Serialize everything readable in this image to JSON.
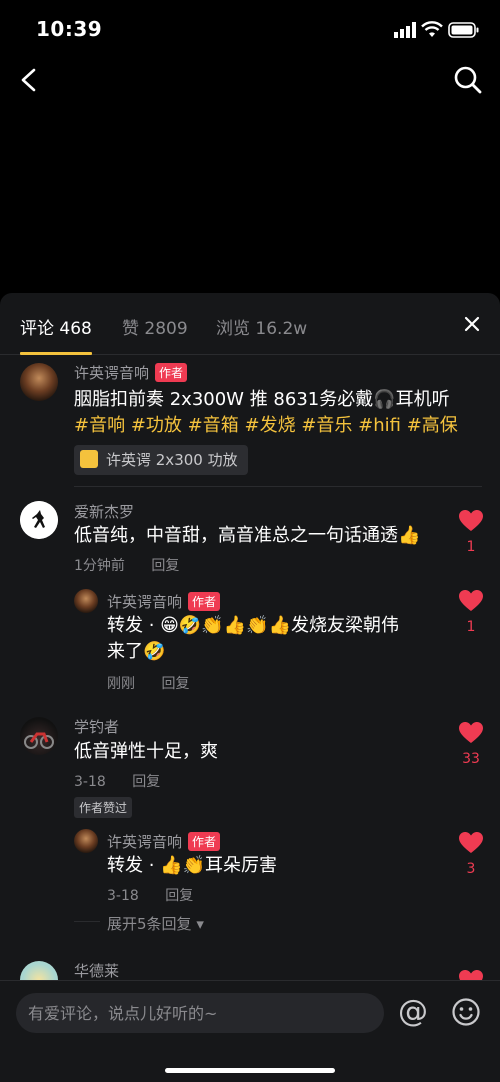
{
  "status": {
    "time": "10:39"
  },
  "tabs": {
    "comments": "评论 468",
    "likes": "赞 2809",
    "views": "浏览 16.2w"
  },
  "input": {
    "placeholder": "有爱评论，说点儿好听的~"
  },
  "author_badge": "作者",
  "reply_label": "回复",
  "post": {
    "user": "许英谔音响",
    "text_line1": "胭脂扣前奏 2x300W 推 8631务必戴🎧耳机听",
    "tags": [
      "#音响",
      "#功放",
      "#音箱",
      "#发烧",
      "#音乐",
      "#hifi",
      "#高保"
    ],
    "product": "许英谔 2x300 功放"
  },
  "comments": [
    {
      "user": "爱新杰罗",
      "text": "低音纯，中音甜，高音准总之一句话通透👍",
      "time": "1分钟前",
      "likes": "1",
      "reply": {
        "user": "许英谔音响",
        "text_line1": "转发 · 😁🤣👏👍👏👍发烧友梁朝伟",
        "text_line2": "来了🤣",
        "time": "刚刚",
        "likes": "1"
      }
    },
    {
      "user": "学钓者",
      "text": "低音弹性十足，爽",
      "time": "3-18",
      "likes": "33",
      "approved": "作者赞过",
      "reply": {
        "user": "许英谔音响",
        "text_line1": "转发 · 👍👏耳朵厉害",
        "time": "3-18",
        "likes": "3"
      },
      "expand": "展开5条回复"
    },
    {
      "user": "华德莱"
    }
  ],
  "colors": {
    "accent": "#f4c23d",
    "like": "#ef3b52",
    "sheet": "#161719"
  }
}
